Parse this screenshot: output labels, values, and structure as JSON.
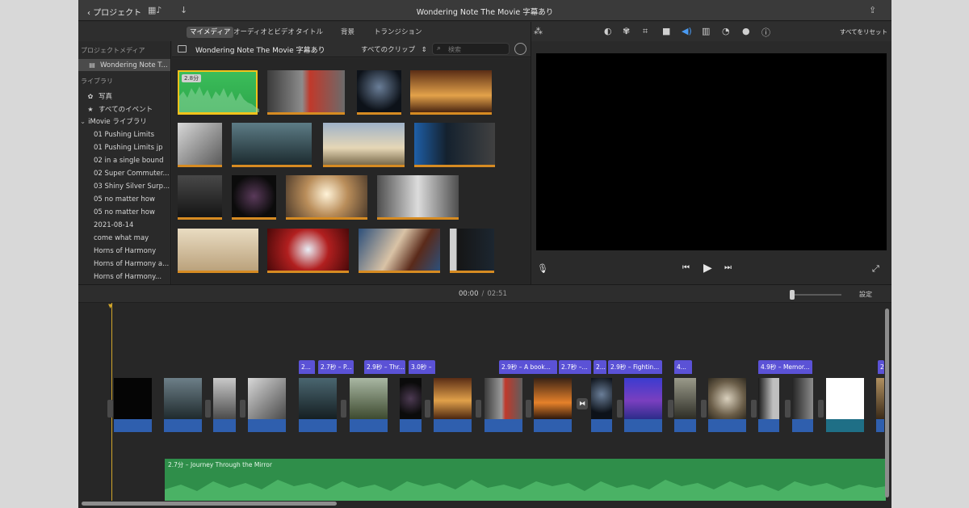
{
  "titlebar": {
    "back_label": "プロジェクト",
    "title": "Wondering Note The Movie 字幕あり"
  },
  "tabs": [
    {
      "label": "マイメディア",
      "active": true
    },
    {
      "label": "オーディオとビデオ",
      "active": false
    },
    {
      "label": "タイトル",
      "active": false
    },
    {
      "label": "背景",
      "active": false
    },
    {
      "label": "トランジション",
      "active": false
    }
  ],
  "sidebar": {
    "project_header": "プロジェクトメディア",
    "project_item": "Wondering Note T...",
    "library_header": "ライブラリ",
    "photos": "写真",
    "all_events": "すべてのイベント",
    "library_name": "iMovie ライブラリ",
    "events": [
      "01 Pushing Limits",
      "01 Pushing Limits jp",
      "02 in a single bound",
      "02 Super Commuter...",
      "03 Shiny Silver Surp...",
      "05 no matter how",
      "05 no matter how",
      "2021-08-14",
      "come what may",
      "Horns of Harmony",
      "Horns of Harmony a...",
      "Horns of Harmony..."
    ]
  },
  "browser": {
    "title": "Wondering Note The Movie 字幕あり",
    "filter": "すべてのクリップ",
    "search_placeholder": "検索",
    "first_clip_duration": "2.8分"
  },
  "viewer": {
    "reset_label": "すべてをリセット"
  },
  "timeline": {
    "current_time": "00:00",
    "separator": "/",
    "total_time": "02:51",
    "settings_label": "設定",
    "clip_labels": [
      "2...",
      "2.7秒 – P...",
      "2.9秒 – Thr...",
      "3.0秒 –",
      "2.9秒 – A book...",
      "2.7秒 –...",
      "2...",
      "2.9秒 – Fightin...",
      "4...",
      "4.9秒 – Memor...",
      "2"
    ],
    "music_label": "2.7分 – Journey Through the Mirror"
  },
  "colors": {
    "accent_orange": "#d68b22",
    "selection_yellow": "#f2c21b",
    "clip_label_purple": "#5b52d6",
    "clip_audio_blue": "#2f5fae",
    "music_green": "#2f8e4a",
    "playhead": "#d1a52a"
  }
}
